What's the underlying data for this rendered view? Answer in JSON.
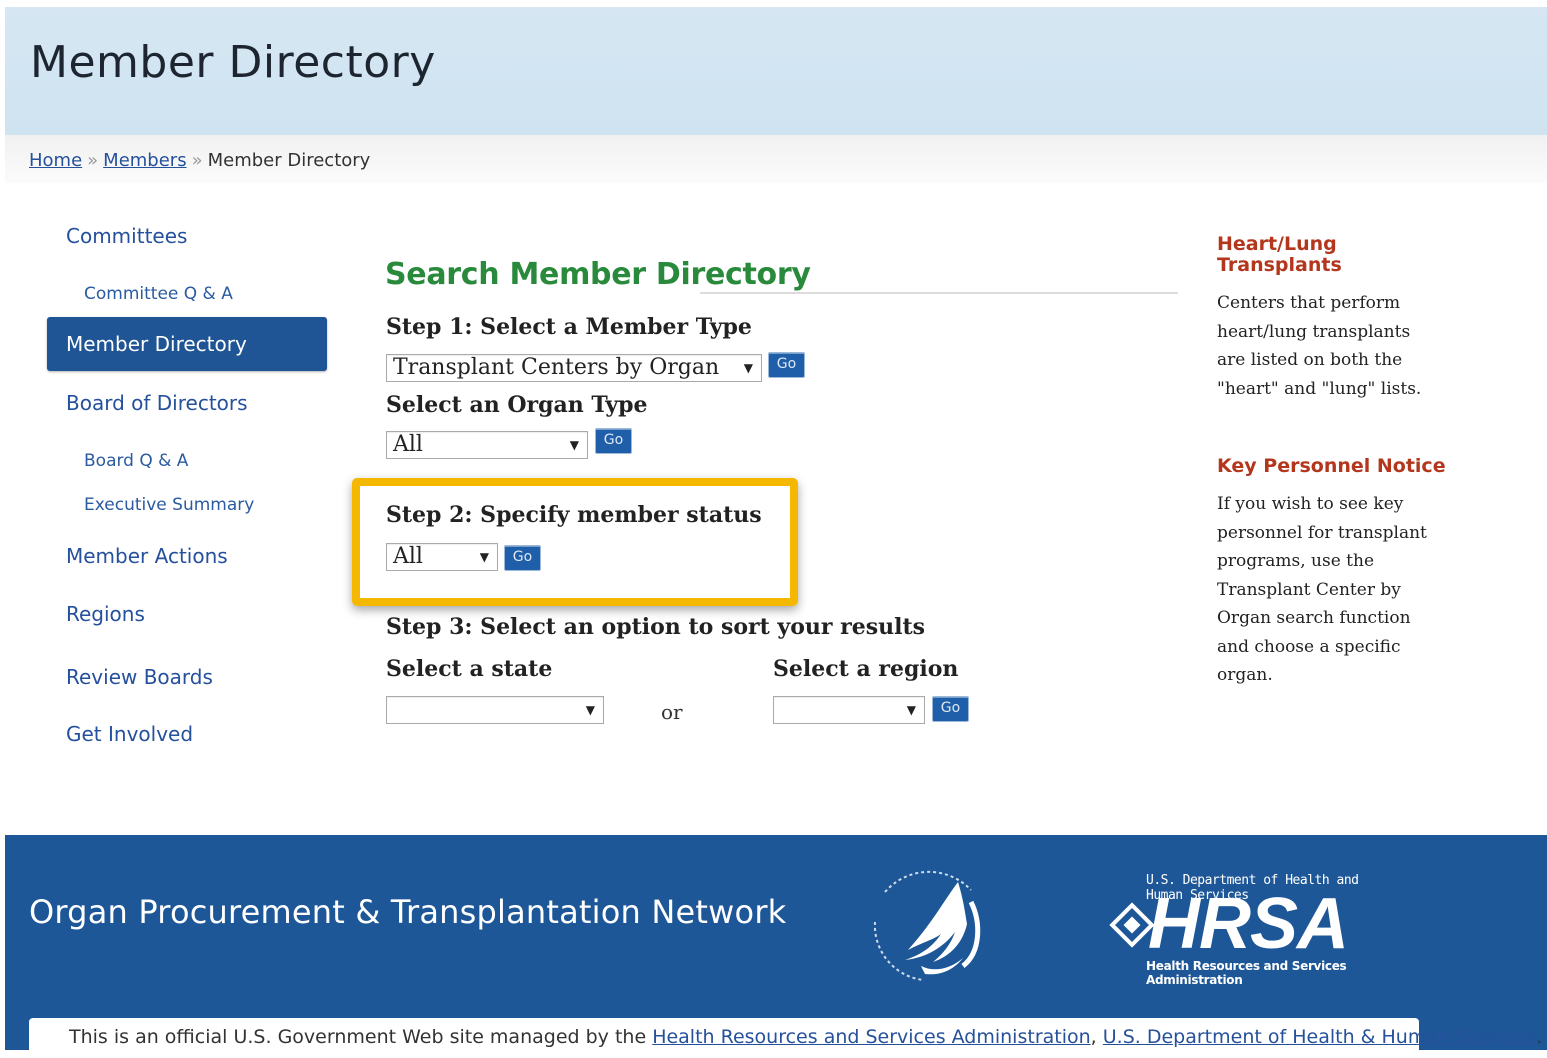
{
  "header": {
    "title": "Member Directory"
  },
  "breadcrumb": {
    "home": "Home",
    "sep1": "»",
    "members": "Members",
    "sep2": "»",
    "current": "Member Directory"
  },
  "nav": {
    "committees": "Committees",
    "committee_qa": "Committee Q & A",
    "member_directory": "Member Directory",
    "board_of_directors": "Board of Directors",
    "board_qa": "Board Q & A",
    "executive_summary": "Executive Summary",
    "member_actions": "Member Actions",
    "regions": "Regions",
    "review_boards": "Review Boards",
    "get_involved": "Get Involved"
  },
  "main": {
    "title": "Search Member Directory",
    "step1_label": "Step 1: Select a Member Type",
    "member_type_value": "Transplant Centers by Organ",
    "organ_label": "Select an Organ Type",
    "organ_value": "All",
    "step2_label": "Step 2: Specify member status",
    "status_value": "All",
    "step3_label": "Step 3: Select an option to sort your results",
    "state_label": "Select a state",
    "state_value": "",
    "or_text": "or",
    "region_label": "Select a region",
    "region_value": "",
    "go_label": "Go",
    "arrow": "▼"
  },
  "sidebar": {
    "heartlung_title_1": "Heart/Lung",
    "heartlung_title_2": "Transplants",
    "heartlung_text": "Centers that perform heart/lung transplants are listed on both the \"heart\" and \"lung\" lists.",
    "key_title": "Key Personnel Notice",
    "key_text": "If you wish to see key personnel for transplant programs, use the Transplant Center by Organ search function and choose a specific organ."
  },
  "footer": {
    "org_name": "Organ Procurement & Transplantation Network",
    "hrsa_top": "U.S. Department of Health and Human Services",
    "hrsa_big": "HRSA",
    "hrsa_bottom": "Health Resources and Services Administration",
    "gov_text_1": "This is an official U.S. Government Web site managed by the ",
    "gov_link_1": "Health Resources and Services Administration",
    "gov_comma": ", ",
    "gov_link_2": "U.S. Department of Health & Human Services",
    "gov_end": "."
  },
  "colors": {
    "accent_blue": "#1f5495",
    "title_green": "#2a8a3c",
    "sidebar_red": "#b3361d",
    "highlight": "#f4b800",
    "footer_blue": "#1e5797"
  }
}
